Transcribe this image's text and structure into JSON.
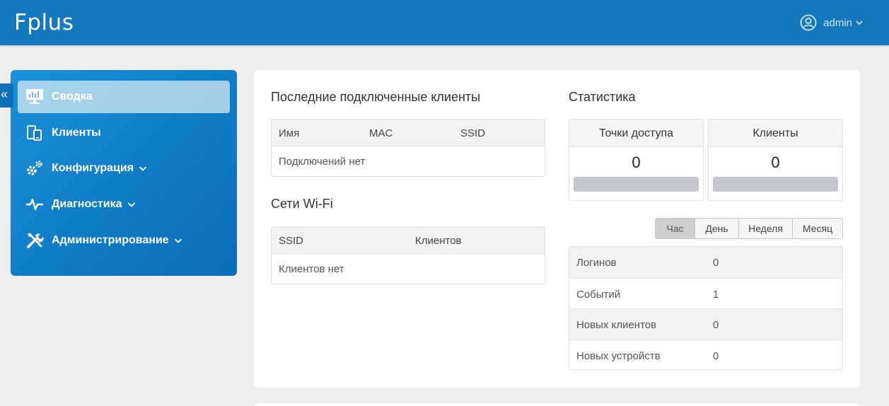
{
  "header": {
    "logo": "Fplus",
    "user": "admin"
  },
  "sidebar": {
    "collapse_glyph": "«",
    "items": [
      {
        "label": "Сводка",
        "icon": "dashboard-icon",
        "active": true
      },
      {
        "label": "Клиенты",
        "icon": "devices-icon"
      },
      {
        "label": "Конфигурация",
        "icon": "gears-icon",
        "expandable": true
      },
      {
        "label": "Диагностика",
        "icon": "pulse-icon",
        "expandable": true
      },
      {
        "label": "Администрирование",
        "icon": "tools-icon",
        "expandable": true
      }
    ]
  },
  "clients_section": {
    "title": "Последние подключенные клиенты",
    "columns": [
      "Имя",
      "MAC",
      "SSID"
    ],
    "empty": "Подключений нет"
  },
  "wifi_section": {
    "title": "Сети Wi-Fi",
    "columns": [
      "SSID",
      "Клиентов"
    ],
    "empty": "Клиентов нет"
  },
  "stats_section": {
    "title": "Статистика",
    "boxes": [
      {
        "label": "Точки доступа",
        "value": "0"
      },
      {
        "label": "Клиенты",
        "value": "0"
      }
    ],
    "periods": [
      "Час",
      "День",
      "Неделя",
      "Месяц"
    ],
    "active_period": "Час",
    "rows": [
      {
        "label": "Логинов",
        "value": "0"
      },
      {
        "label": "Событий",
        "value": "1"
      },
      {
        "label": "Новых клиентов",
        "value": "0"
      },
      {
        "label": "Новых устройств",
        "value": "0"
      }
    ]
  },
  "colors": {
    "header": "#1478bd",
    "sidebar": "#0f7cc6",
    "page_bg": "#eeeeee"
  }
}
